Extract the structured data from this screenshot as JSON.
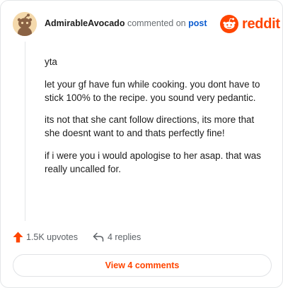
{
  "comment": {
    "username": "AdmirableAvocado",
    "action_text": "commented on",
    "post_link_text": "post",
    "paragraphs": [
      "yta",
      "let your gf have fun while cooking. you dont have to stick 100% to the recipe. you sound very pedantic.",
      "its not that she cant follow directions, its more that she doesnt want to and thats perfectly fine!",
      "if i were you i would apologise to her asap. that was really uncalled for."
    ]
  },
  "brand": {
    "name": "reddit",
    "color": "#ff4500"
  },
  "footer": {
    "upvotes": "1.5K upvotes",
    "replies": "4 replies",
    "upvote_icon": "upvote-arrow-icon",
    "reply_icon": "reply-arrow-icon"
  },
  "view_comments_label": "View 4 comments"
}
